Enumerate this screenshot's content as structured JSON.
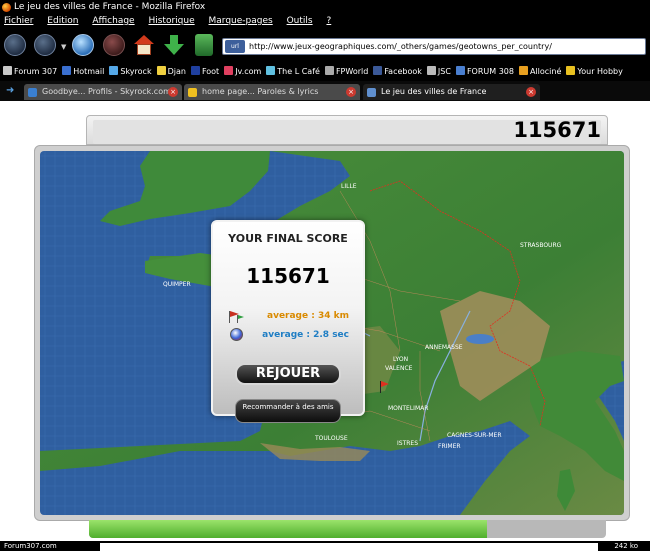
{
  "window": {
    "title": "Le jeu des villes de France - Mozilla Firefox"
  },
  "menu": {
    "items": [
      "Fichier",
      "Edition",
      "Affichage",
      "Historique",
      "Marque-pages",
      "Outils",
      "?"
    ]
  },
  "navbar": {
    "url": "http://www.jeux-geographiques.com/_others/games/geotowns_per_country/"
  },
  "bookmarks": [
    {
      "label": "Forum 307",
      "color": "#c8c8c8"
    },
    {
      "label": "Hotmail",
      "color": "#3a6fd0"
    },
    {
      "label": "Skyrock",
      "color": "#55a8e8"
    },
    {
      "label": "Djan",
      "color": "#f0d040"
    },
    {
      "label": "Foot",
      "color": "#1f3f9f"
    },
    {
      "label": "Jv.com",
      "color": "#e04060"
    },
    {
      "label": "The L Café",
      "color": "#60c0e0"
    },
    {
      "label": "FPWorld",
      "color": "#aaaaaa"
    },
    {
      "label": "Facebook",
      "color": "#3b5998"
    },
    {
      "label": "JSC",
      "color": "#bbbbbb"
    },
    {
      "label": "FORUM 308",
      "color": "#4a7fd0"
    },
    {
      "label": "Allociné",
      "color": "#e8a020"
    },
    {
      "label": "Your Hobby",
      "color": "#e8c020"
    }
  ],
  "tabs": [
    {
      "label": "Goodbye... Profils - Skyrock.com",
      "active": false,
      "color": "#3a7fd0"
    },
    {
      "label": "home page... Paroles & lyrics",
      "active": false,
      "color": "#f0c020"
    },
    {
      "label": "Le jeu des villes de France",
      "active": true,
      "color": "#6090d0"
    }
  ],
  "score_bar": {
    "score": "115671"
  },
  "map": {
    "cities": [
      "LILLE",
      "QUIMPER",
      "STRASBOURG",
      "ANNEMASSE",
      "LYON",
      "VALENCE",
      "MONTELIMAR",
      "TOULOUSE",
      "ISTRES",
      "CAGNES-SUR-MER",
      "FRIMER"
    ],
    "colors": {
      "sea": "#2f5fa0",
      "land": "#3d8a3a",
      "mountain": "#9d8a5a"
    }
  },
  "score_panel": {
    "title": "YOUR FINAL SCORE",
    "score": "115671",
    "avg_distance": "average : 34 km",
    "avg_time": "average : 2.8 sec",
    "replay_label": "REJOUER",
    "recommend_label": "Recommander à des amis"
  },
  "progress": {
    "fraction": 0.77
  },
  "status": {
    "left": "Forum307.com",
    "right": "242 ko"
  }
}
